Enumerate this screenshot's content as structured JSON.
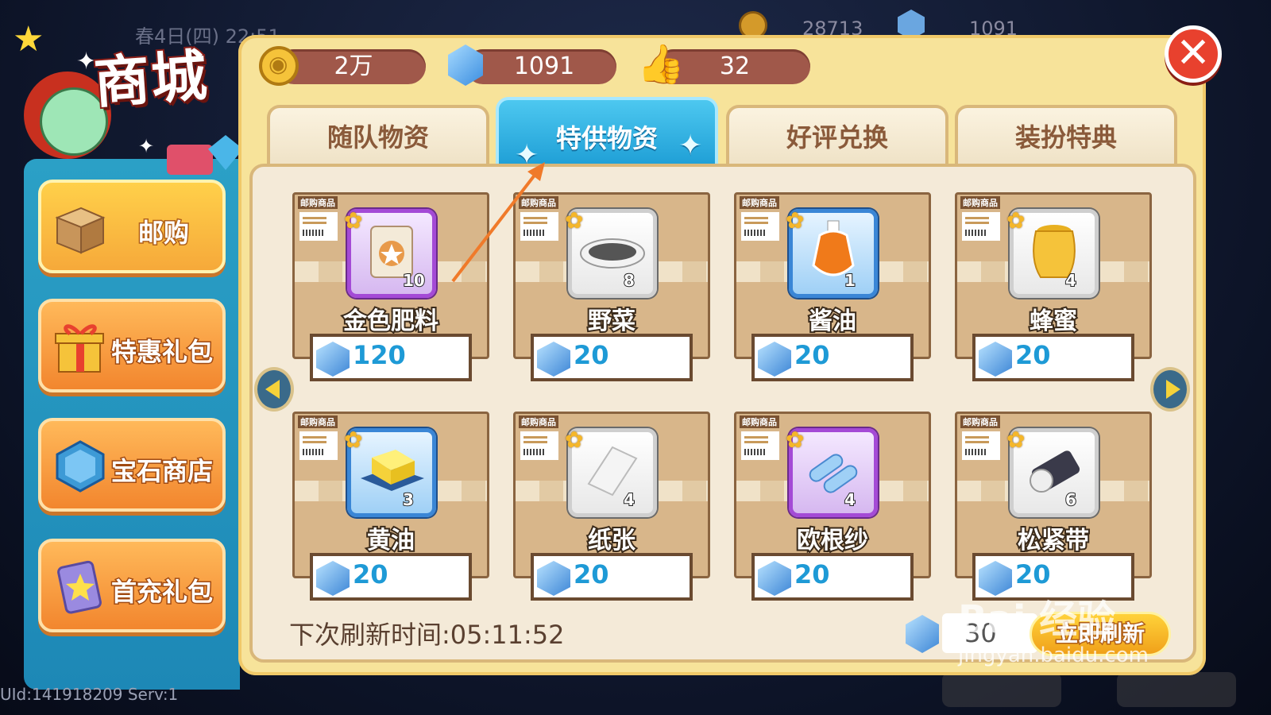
{
  "background": {
    "date_text": "春4日(四) 22:51",
    "hud_coins": "28713",
    "hud_gems": "1091",
    "uid_text": "UId:141918209 Serv:1"
  },
  "logo": {
    "title": "商城"
  },
  "sidebar": {
    "items": [
      {
        "label": "邮购",
        "icon": "cardboard-box-icon",
        "active": true
      },
      {
        "label": "特惠礼包",
        "icon": "gift-box-icon"
      },
      {
        "label": "宝石商店",
        "icon": "gem-icon"
      },
      {
        "label": "首充礼包",
        "icon": "card-star-icon"
      }
    ]
  },
  "resources": {
    "coins": "2万",
    "gems": "1091",
    "likes": "32"
  },
  "tabs": [
    {
      "label": "随队物资",
      "active": false
    },
    {
      "label": "特供物资",
      "active": true
    },
    {
      "label": "好评兑换",
      "active": false
    },
    {
      "label": "装扮特典",
      "active": false
    }
  ],
  "card_tag": "邮购商品",
  "items": [
    {
      "name": "金色肥料",
      "qty": "10",
      "price": "120",
      "frame": "purple",
      "icon": "fertilizer-bag-icon"
    },
    {
      "name": "野菜",
      "qty": "8",
      "price": "20",
      "frame": "white",
      "icon": "greens-plate-icon"
    },
    {
      "name": "酱油",
      "qty": "1",
      "price": "20",
      "frame": "blue",
      "icon": "soy-sauce-jug-icon"
    },
    {
      "name": "蜂蜜",
      "qty": "4",
      "price": "20",
      "frame": "white",
      "icon": "honey-pot-icon"
    },
    {
      "name": "黄油",
      "qty": "3",
      "price": "20",
      "frame": "blue",
      "icon": "butter-icon"
    },
    {
      "name": "纸张",
      "qty": "4",
      "price": "20",
      "frame": "white",
      "icon": "paper-icon"
    },
    {
      "name": "欧根纱",
      "qty": "4",
      "price": "20",
      "frame": "purple",
      "icon": "organza-rolls-icon"
    },
    {
      "name": "松紧带",
      "qty": "6",
      "price": "20",
      "frame": "white",
      "icon": "elastic-band-icon"
    }
  ],
  "footer": {
    "refresh_time": "下次刷新时间:05:11:52",
    "refresh_cost": "30",
    "refresh_button": "立即刷新"
  },
  "watermark": {
    "main": "Bai 经验",
    "sub": "jingyan.baidu.com"
  },
  "colors": {
    "accent_tab": "#1f9fd6",
    "panel": "#f7e39a",
    "price_text": "#1e9ad6",
    "close": "#e8412e"
  }
}
